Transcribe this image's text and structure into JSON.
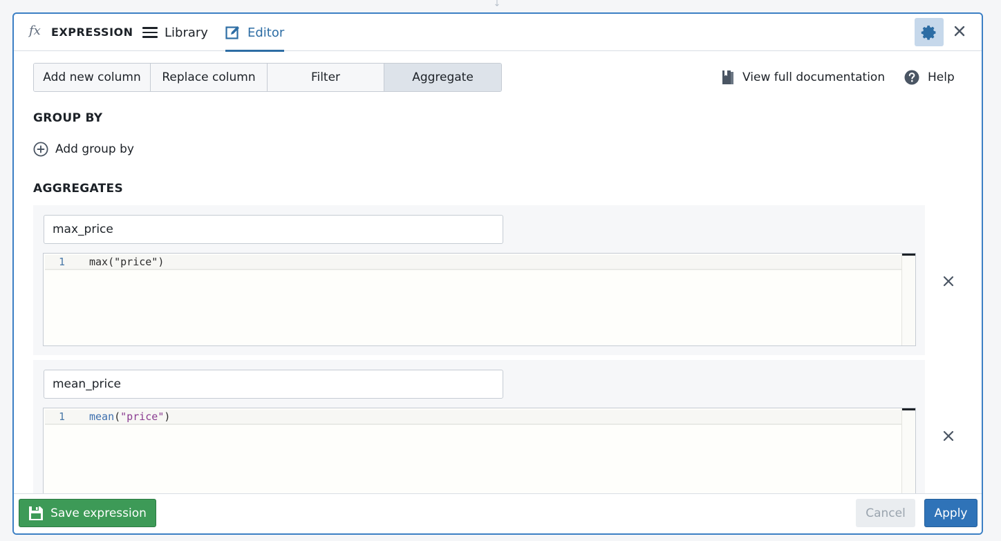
{
  "header": {
    "title": "EXPRESSION",
    "tabs": [
      {
        "label": "Library",
        "icon": "hamburger-icon"
      },
      {
        "label": "Editor",
        "icon": "edit-icon",
        "active": true
      }
    ]
  },
  "modes": {
    "options": [
      "Add new column",
      "Replace column",
      "Filter",
      "Aggregate"
    ],
    "selected": "Aggregate"
  },
  "links": {
    "docs": "View full documentation",
    "help": "Help"
  },
  "group_by": {
    "title": "GROUP BY",
    "add_label": "Add group by"
  },
  "aggregates": {
    "title": "AGGREGATES",
    "items": [
      {
        "name": "max_price",
        "line_number": "1",
        "code_fn": "max",
        "code_arg": "(\"price\")"
      },
      {
        "name": "mean_price",
        "line_number": "1",
        "code_fn": "mean",
        "code_arg_open": "(",
        "code_arg_str": "\"price\"",
        "code_arg_close": ")"
      }
    ]
  },
  "footer": {
    "save_label": "Save expression",
    "cancel_label": "Cancel",
    "apply_label": "Apply"
  },
  "colors": {
    "accent": "#2d6da4",
    "save_green": "#3d9a57",
    "apply_blue": "#2f73b8"
  }
}
